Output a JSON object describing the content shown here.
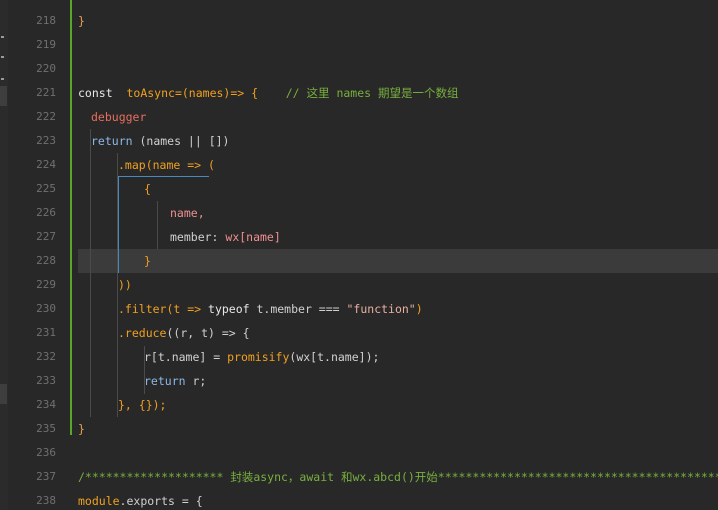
{
  "gutter": {
    "line_numbers": [
      "218",
      "219",
      "220",
      "221",
      "222",
      "223",
      "224",
      "225",
      "226",
      "227",
      "228",
      "229",
      "230",
      "231",
      "232",
      "233",
      "234",
      "235",
      "236",
      "237",
      "238"
    ]
  },
  "code": {
    "l218": "}",
    "l221_const": "const",
    "l221_name": "toAsync",
    "l221_sig": "=(names)=> {",
    "l221_comment": "// 这里 names 期望是一个数组",
    "l222": "debugger",
    "l223_kw": "return",
    "l223_rest": " (names || [])",
    "l224_map": ".map",
    "l224_rest": "(name => (",
    "l225": "{",
    "l226": "name,",
    "l227_prop": "member: ",
    "l227_val": "wx[name]",
    "l228": "}",
    "l229": "))",
    "l230_filter": ".filter",
    "l230_a": "(t => ",
    "l230_typeof": "typeof",
    "l230_b": " t.member === ",
    "l230_str": "\"function\"",
    "l230_c": ")",
    "l231_reduce": ".reduce",
    "l231_rest": "((r, t) => {",
    "l232_a": "r[t.name] = ",
    "l232_fn": "promisify",
    "l232_b": "(wx[t.name]);",
    "l233_kw": "return",
    "l233_rest": " r;",
    "l234": "}, {});",
    "l235": "}",
    "l237": "/******************** 封装async，await 和wx.abcd()开始**************************************************",
    "l238_a": "module",
    "l238_b": ".exports = {"
  },
  "colors": {
    "background": "#282828",
    "keyword": "#f0a020",
    "comment": "#78b03e",
    "debugger": "#e86e5e",
    "return": "#8bb8e8",
    "string": "#e8b0a0",
    "modified_bar": "#58a62a"
  }
}
